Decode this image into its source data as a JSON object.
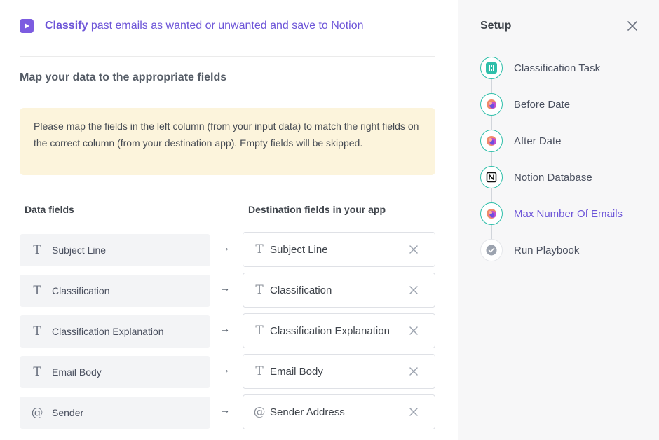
{
  "header": {
    "title_bold": "Classify",
    "title_rest": " past emails as wanted or unwanted and save to Notion"
  },
  "section_title": "Map your data to the appropriate fields",
  "notice": "Please map the fields in the left column (from your input data) to match the right fields on the correct column (from your destination app). Empty fields will be skipped.",
  "columns": {
    "left": "Data fields",
    "right": "Destination fields in your app"
  },
  "mappings": [
    {
      "source_icon": "text-icon",
      "source_glyph": "T",
      "source": "Subject Line",
      "arrow": "→",
      "dest_icon": "text-icon",
      "dest_glyph": "T",
      "dest": "Subject Line"
    },
    {
      "source_icon": "text-icon",
      "source_glyph": "T",
      "source": "Classification",
      "arrow": "→",
      "dest_icon": "text-icon",
      "dest_glyph": "T",
      "dest": "Classification"
    },
    {
      "source_icon": "text-icon",
      "source_glyph": "T",
      "source": "Classification Explanation",
      "arrow": "→",
      "dest_icon": "text-icon",
      "dest_glyph": "T",
      "dest": "Classification Explanation"
    },
    {
      "source_icon": "text-icon",
      "source_glyph": "T",
      "source": "Email Body",
      "arrow": "→",
      "dest_icon": "text-icon",
      "dest_glyph": "T",
      "dest": "Email Body"
    },
    {
      "source_icon": "at-icon",
      "source_glyph": "@",
      "source": "Sender",
      "arrow": "→",
      "dest_icon": "at-icon",
      "dest_glyph": "@",
      "dest": "Sender Address"
    }
  ],
  "setup": {
    "title": "Setup",
    "steps": [
      {
        "label": "Classification Task",
        "icon": "grid-icon",
        "state": "done"
      },
      {
        "label": "Before Date",
        "icon": "blob-icon",
        "state": "done"
      },
      {
        "label": "After Date",
        "icon": "blob-icon",
        "state": "done"
      },
      {
        "label": "Notion Database",
        "icon": "notion-icon",
        "state": "done"
      },
      {
        "label": "Max Number Of Emails",
        "icon": "blob-icon",
        "state": "active"
      },
      {
        "label": "Run Playbook",
        "icon": "check-icon",
        "state": "pending"
      }
    ]
  },
  "colors": {
    "accent": "#6d55d8",
    "teal": "#2fbfaa",
    "notice_bg": "#fcf4dc"
  }
}
